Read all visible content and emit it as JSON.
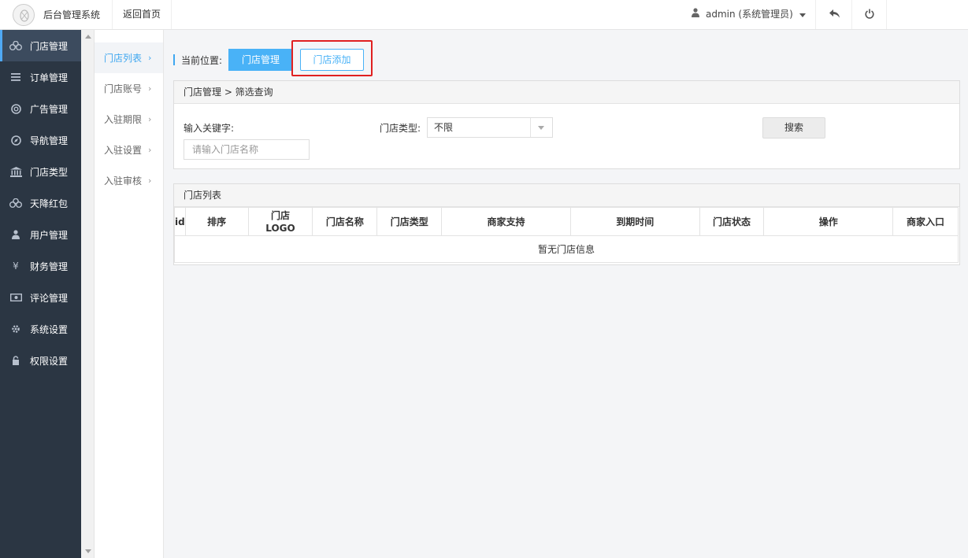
{
  "topbar": {
    "system_title": "后台管理系统",
    "back_home": "返回首页",
    "user": "admin (系统管理员)"
  },
  "sidebar": {
    "items": [
      {
        "label": "门店管理",
        "icon": "cubes-icon"
      },
      {
        "label": "订单管理",
        "icon": "list-icon"
      },
      {
        "label": "广告管理",
        "icon": "lifebuoy-icon"
      },
      {
        "label": "导航管理",
        "icon": "compass-icon"
      },
      {
        "label": "门店类型",
        "icon": "bank-icon"
      },
      {
        "label": "天降红包",
        "icon": "cubes-icon"
      },
      {
        "label": "用户管理",
        "icon": "user-icon"
      },
      {
        "label": "财务管理",
        "icon": "yen-icon"
      },
      {
        "label": "评论管理",
        "icon": "money-icon"
      },
      {
        "label": "系统设置",
        "icon": "gear-icon"
      },
      {
        "label": "权限设置",
        "icon": "lock-icon"
      }
    ]
  },
  "submenu": {
    "items": [
      {
        "label": "门店列表"
      },
      {
        "label": "门店账号"
      },
      {
        "label": "入驻期限"
      },
      {
        "label": "入驻设置"
      },
      {
        "label": "入驻审核"
      }
    ]
  },
  "location": {
    "label": "当前位置:",
    "current": "门店管理",
    "add_button": "门店添加"
  },
  "filter": {
    "header": "门店管理 > 筛选查询",
    "keyword_label": "输入关键字:",
    "keyword_placeholder": "请输入门店名称",
    "type_label": "门店类型:",
    "type_value": "不限",
    "search_button": "搜索"
  },
  "list": {
    "header": "门店列表",
    "columns": [
      "id",
      "排序",
      "门店LOGO",
      "门店名称",
      "门店类型",
      "商家支持",
      "到期时间",
      "门店状态",
      "操作",
      "商家入口"
    ],
    "logo_col_line1": "门店",
    "logo_col_line2": "LOGO",
    "empty": "暂无门店信息"
  },
  "colors": {
    "accent": "#49b2f7",
    "sidebar_bg": "#2b3643",
    "highlight": "#e02020"
  }
}
